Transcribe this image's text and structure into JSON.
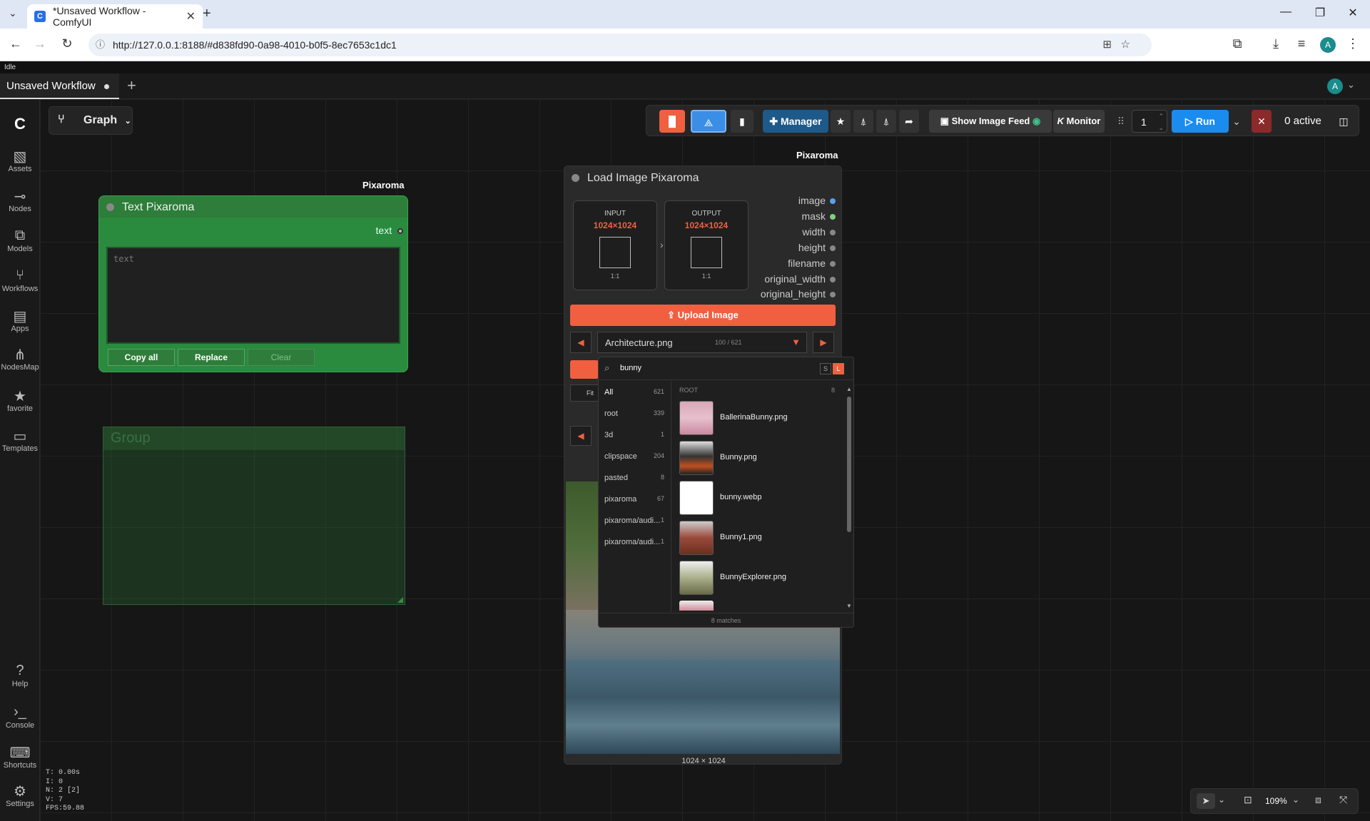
{
  "browser": {
    "tab_title": "*Unsaved Workflow - ComfyUI",
    "url": "http://127.0.0.1:8188/#d838fd90-0a98-4010-b0f5-8ec7653c1dc1",
    "profile_initial": "A"
  },
  "status_text": "Idle",
  "workflow_tab": "Unsaved Workflow",
  "user_initial": "A",
  "graph_button": "Graph",
  "sidebar": {
    "items": [
      {
        "label": "Assets",
        "icon": "image-icon"
      },
      {
        "label": "Nodes",
        "icon": "nodes-icon"
      },
      {
        "label": "Models",
        "icon": "models-icon"
      },
      {
        "label": "Workflows",
        "icon": "workflows-icon"
      },
      {
        "label": "Apps",
        "icon": "apps-icon"
      },
      {
        "label": "NodesMap",
        "icon": "nodesmap-icon"
      },
      {
        "label": "favorite",
        "icon": "star-icon"
      },
      {
        "label": "Templates",
        "icon": "templates-icon"
      }
    ],
    "bottom": [
      {
        "label": "Help",
        "icon": "help-icon"
      },
      {
        "label": "Console",
        "icon": "console-icon"
      },
      {
        "label": "Shortcuts",
        "icon": "keyboard-icon"
      },
      {
        "label": "Settings",
        "icon": "gear-icon"
      }
    ]
  },
  "toolbar": {
    "manager": "Manager",
    "show_image_feed": "Show Image Feed",
    "monitor": "Monitor",
    "queue_count": "1",
    "run": "Run",
    "active": "0 active"
  },
  "text_node": {
    "badge": "Pixaroma",
    "title": "Text Pixaroma",
    "output": "text",
    "placeholder": "text",
    "copy_all": "Copy all",
    "replace": "Replace",
    "clear": "Clear"
  },
  "group": {
    "title": "Group"
  },
  "load_node": {
    "badge": "Pixaroma",
    "title": "Load Image Pixaroma",
    "input_label": "INPUT",
    "input_size": "1024×1024",
    "input_ratio": "1:1",
    "output_label": "OUTPUT",
    "output_size": "1024×1024",
    "output_ratio": "1:1",
    "outputs": [
      "image",
      "mask",
      "width",
      "height",
      "filename",
      "original_width",
      "original_height"
    ],
    "upload": "Upload Image",
    "selected_file": "Architecture.png",
    "file_index": "100 / 621",
    "fit": "Fit",
    "image_size": "1024 × 1024"
  },
  "popup": {
    "search_value": "bunny",
    "size_s": "S",
    "size_l": "L",
    "folders": [
      {
        "name": "All",
        "count": "621"
      },
      {
        "name": "root",
        "count": "339"
      },
      {
        "name": "3d",
        "count": "1"
      },
      {
        "name": "clipspace",
        "count": "204"
      },
      {
        "name": "pasted",
        "count": "8"
      },
      {
        "name": "pixaroma",
        "count": "67"
      },
      {
        "name": "pixaroma/audi...",
        "count": "1"
      },
      {
        "name": "pixaroma/audi...",
        "count": "1"
      }
    ],
    "section": "ROOT",
    "section_count": "8",
    "files": [
      "BallerinaBunny.png",
      "Bunny.png",
      "bunny.webp",
      "Bunny1.png",
      "BunnyExplorer.png"
    ],
    "matches": "8 matches"
  },
  "stats": [
    "T: 0.00s",
    "I: 0",
    "N: 2 [2]",
    "V: 7",
    "FPS:59.88"
  ],
  "zoom": "109%"
}
